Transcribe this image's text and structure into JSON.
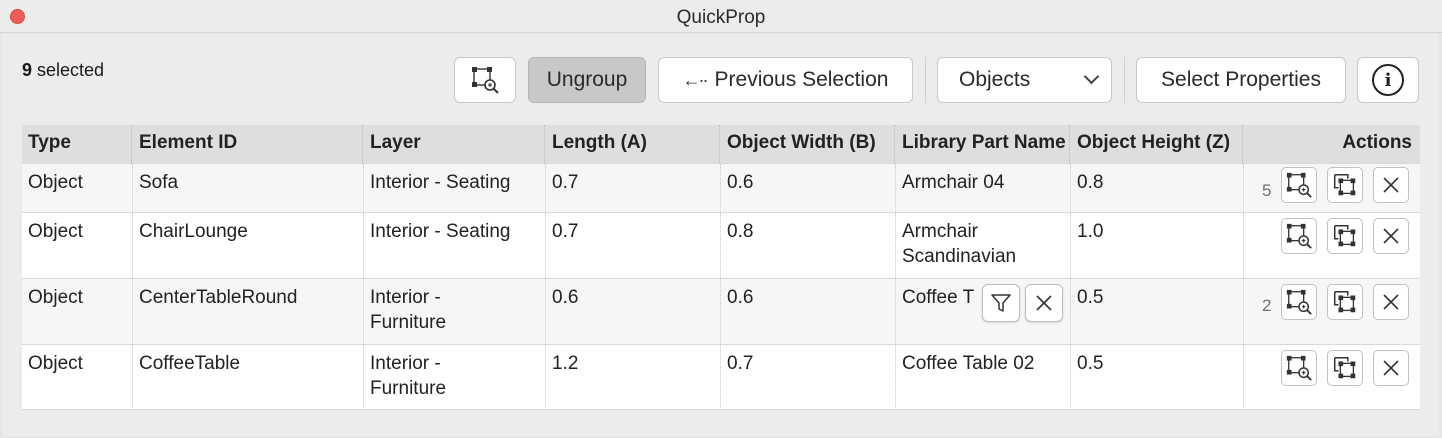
{
  "window": {
    "title": "QuickProp"
  },
  "toolbar": {
    "selection_count": "9",
    "selection_suffix": " selected",
    "zoom_icon": "zoom-to-selection-icon",
    "ungroup_label": "Ungroup",
    "previous_selection_label": "Previous Selection",
    "objects_dropdown_value": "Objects",
    "select_properties_label": "Select Properties",
    "info_icon": "info-icon"
  },
  "table": {
    "columns": [
      "Type",
      "Element ID",
      "Layer",
      "Length (A)",
      "Object Width (B)",
      "Library Part Name",
      "Object Height (Z)",
      "Actions"
    ],
    "rows": [
      {
        "type": "Object",
        "element_id": "Sofa",
        "layer": "Interior - Seating",
        "length": "0.7",
        "width": "0.6",
        "library_part": "Armchair 04",
        "height": "0.8",
        "count": "5"
      },
      {
        "type": "Object",
        "element_id": "ChairLounge",
        "layer": "Interior - Seating",
        "length": "0.7",
        "width": "0.8",
        "library_part": "Armchair Scandinavian",
        "height": "1.0",
        "count": ""
      },
      {
        "type": "Object",
        "element_id": "CenterTableRound",
        "layer": "Interior - Furniture",
        "length": "0.6",
        "width": "0.6",
        "library_part": "Coffee T",
        "height": "0.5",
        "count": "2"
      },
      {
        "type": "Object",
        "element_id": "CoffeeTable",
        "layer": "Interior - Furniture",
        "length": "1.2",
        "width": "0.7",
        "library_part": "Coffee Table 02",
        "height": "0.5",
        "count": ""
      }
    ],
    "action_icons": [
      "zoom-to-element-icon",
      "select-element-icon",
      "remove-icon"
    ]
  },
  "hover_popup": {
    "icons": [
      "filter-icon",
      "clear-icon"
    ]
  },
  "colors": {
    "close_button": "#ee5d55",
    "pressed_button": "#c8c8c8",
    "header_bg": "#dedede"
  }
}
